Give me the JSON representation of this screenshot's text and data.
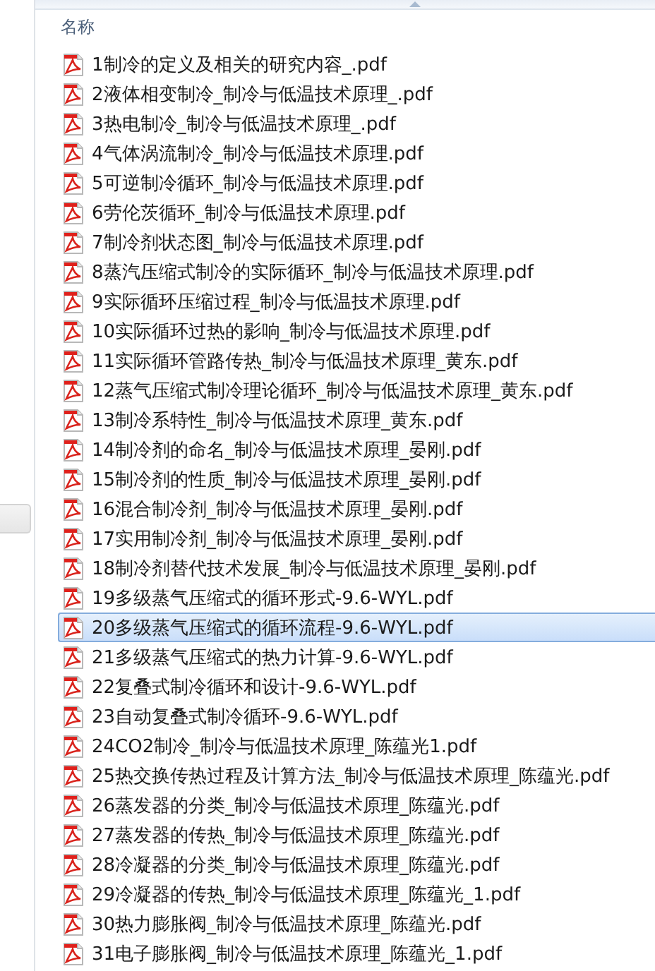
{
  "column_header": {
    "label": "名称",
    "sorted_ascending": true
  },
  "files": [
    {
      "name": "1制冷的定义及相关的研究内容_.pdf",
      "selected": false
    },
    {
      "name": "2液体相变制冷_制冷与低温技术原理_.pdf",
      "selected": false
    },
    {
      "name": "3热电制冷_制冷与低温技术原理_.pdf",
      "selected": false
    },
    {
      "name": "4气体涡流制冷_制冷与低温技术原理.pdf",
      "selected": false
    },
    {
      "name": "5可逆制冷循环_制冷与低温技术原理.pdf",
      "selected": false
    },
    {
      "name": "6劳伦茨循环_制冷与低温技术原理.pdf",
      "selected": false
    },
    {
      "name": "7制冷剂状态图_制冷与低温技术原理.pdf",
      "selected": false
    },
    {
      "name": "8蒸汽压缩式制冷的实际循环_制冷与低温技术原理.pdf",
      "selected": false
    },
    {
      "name": "9实际循环压缩过程_制冷与低温技术原理.pdf",
      "selected": false
    },
    {
      "name": "10实际循环过热的影响_制冷与低温技术原理.pdf",
      "selected": false
    },
    {
      "name": "11实际循环管路传热_制冷与低温技术原理_黄东.pdf",
      "selected": false
    },
    {
      "name": "12蒸气压缩式制冷理论循环_制冷与低温技术原理_黄东.pdf",
      "selected": false
    },
    {
      "name": "13制冷系特性_制冷与低温技术原理_黄东.pdf",
      "selected": false
    },
    {
      "name": "14制冷剂的命名_制冷与低温技术原理_晏刚.pdf",
      "selected": false
    },
    {
      "name": "15制冷剂的性质_制冷与低温技术原理_晏刚.pdf",
      "selected": false
    },
    {
      "name": "16混合制冷剂_制冷与低温技术原理_晏刚.pdf",
      "selected": false
    },
    {
      "name": "17实用制冷剂_制冷与低温技术原理_晏刚.pdf",
      "selected": false
    },
    {
      "name": "18制冷剂替代技术发展_制冷与低温技术原理_晏刚.pdf",
      "selected": false
    },
    {
      "name": "19多级蒸气压缩式的循环形式-9.6-WYL.pdf",
      "selected": false
    },
    {
      "name": "20多级蒸气压缩式的循环流程-9.6-WYL.pdf",
      "selected": true
    },
    {
      "name": "21多级蒸气压缩式的热力计算-9.6-WYL.pdf",
      "selected": false
    },
    {
      "name": "22复叠式制冷循环和设计-9.6-WYL.pdf",
      "selected": false
    },
    {
      "name": "23自动复叠式制冷循环-9.6-WYL.pdf",
      "selected": false
    },
    {
      "name": "24CO2制冷_制冷与低温技术原理_陈蕴光1.pdf",
      "selected": false
    },
    {
      "name": "25热交换传热过程及计算方法_制冷与低温技术原理_陈蕴光.pdf",
      "selected": false
    },
    {
      "name": "26蒸发器的分类_制冷与低温技术原理_陈蕴光.pdf",
      "selected": false
    },
    {
      "name": "27蒸发器的传热_制冷与低温技术原理_陈蕴光.pdf",
      "selected": false
    },
    {
      "name": "28冷凝器的分类_制冷与低温技术原理_陈蕴光.pdf",
      "selected": false
    },
    {
      "name": "29冷凝器的传热_制冷与低温技术原理_陈蕴光_1.pdf",
      "selected": false
    },
    {
      "name": "30热力膨胀阀_制冷与低温技术原理_陈蕴光.pdf",
      "selected": false
    },
    {
      "name": "31电子膨胀阀_制冷与低温技术原理_陈蕴光_1.pdf",
      "selected": false
    }
  ]
}
